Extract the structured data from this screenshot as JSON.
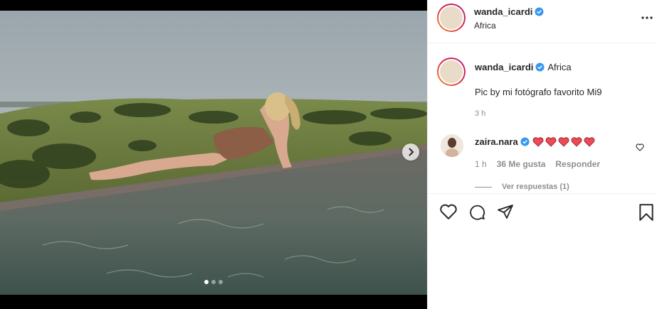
{
  "post": {
    "username": "wanda_icardi",
    "location": "Africa",
    "caption": "Pic by mi fotógrafo favorito Mi9",
    "time_ago": "3 h",
    "carousel": {
      "count": 3,
      "active_index": 0
    }
  },
  "comment": {
    "username": "zaira.nara",
    "hearts": "❤️❤️❤️❤️❤️",
    "time": "1 h",
    "likes": "36 Me gusta",
    "reply_label": "Responder",
    "view_replies": "Ver respuestas (1)"
  },
  "colors": {
    "verified": "#3897f0",
    "heart": "#ed4956",
    "muted": "#8e8e8e"
  },
  "icons": [
    "heart-icon",
    "comment-icon",
    "share-icon",
    "bookmark-icon",
    "more-icon",
    "chevron-right-icon",
    "verified-icon"
  ]
}
